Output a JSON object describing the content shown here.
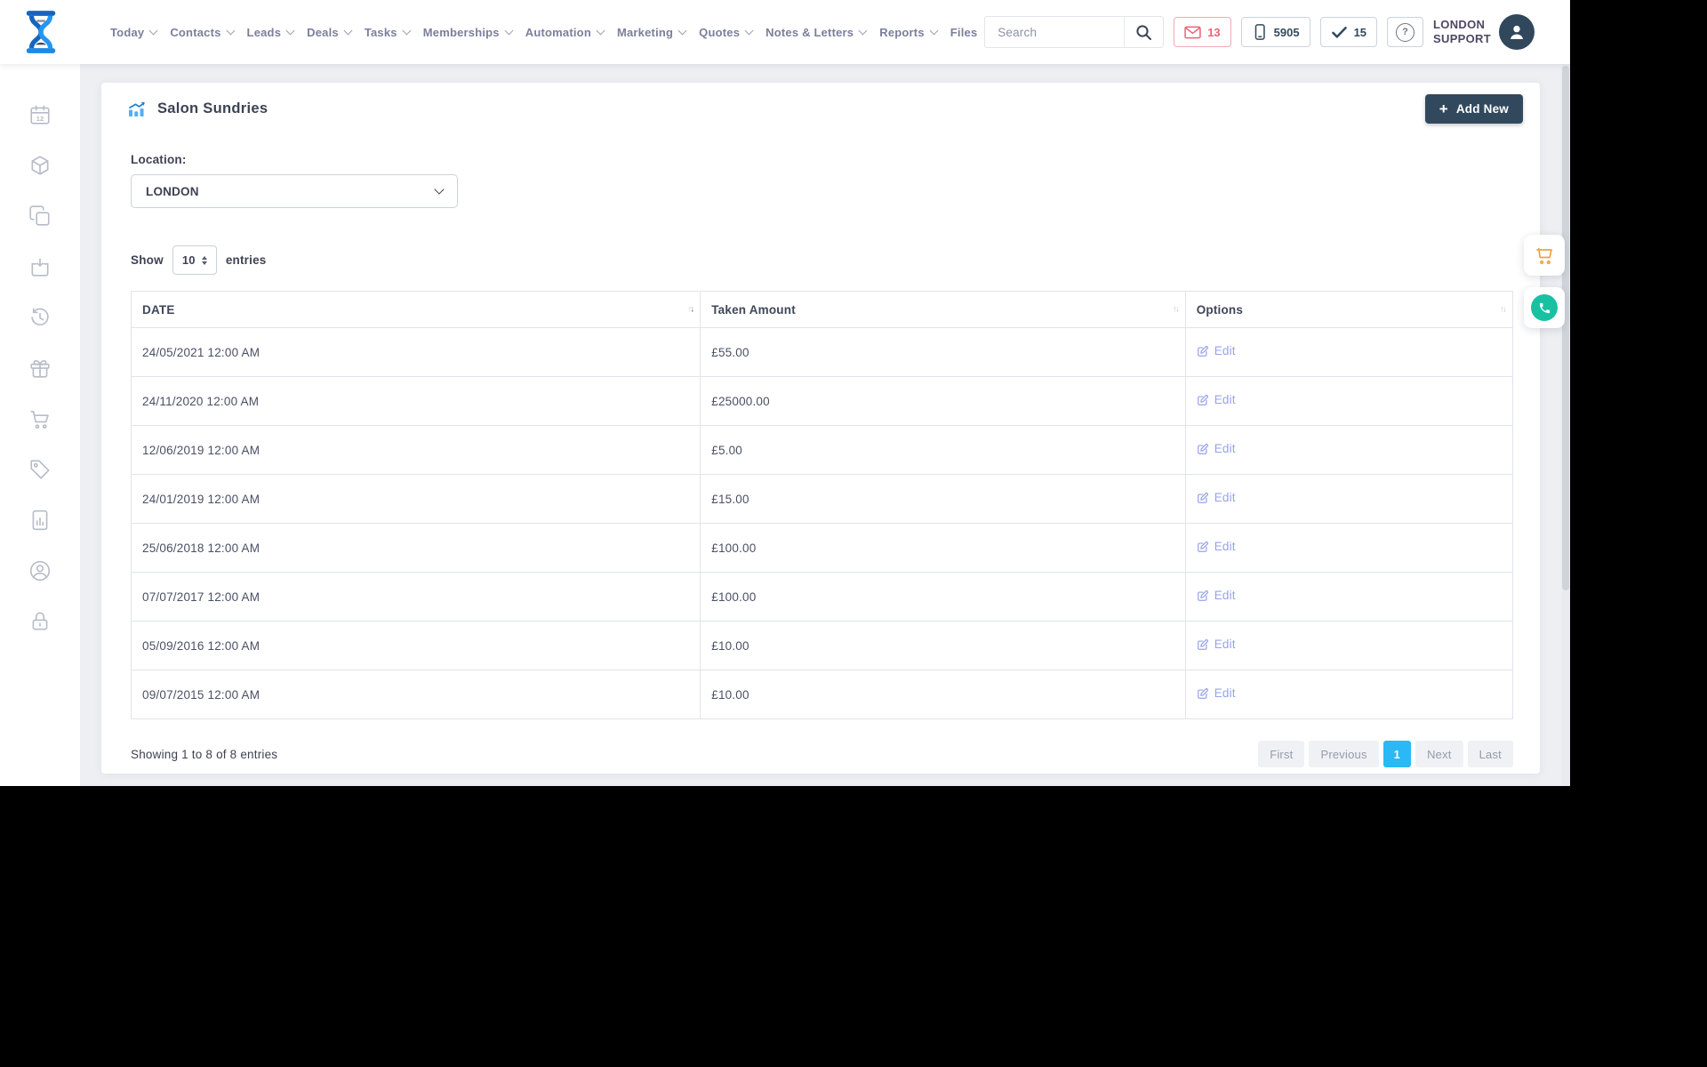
{
  "topbar": {
    "nav": [
      {
        "label": "Today"
      },
      {
        "label": "Contacts"
      },
      {
        "label": "Leads"
      },
      {
        "label": "Deals"
      },
      {
        "label": "Tasks"
      },
      {
        "label": "Memberships"
      },
      {
        "label": "Automation"
      },
      {
        "label": "Marketing"
      },
      {
        "label": "Quotes"
      },
      {
        "label": "Notes & Letters"
      },
      {
        "label": "Reports"
      },
      {
        "label": "Files"
      }
    ],
    "search_placeholder": "Search",
    "messages_count": "13",
    "phone_count": "5905",
    "tasks_count": "15",
    "help_glyph": "?",
    "user_line1": "LONDON",
    "user_line2": "SUPPORT"
  },
  "sidebar": {
    "items": [
      "calendar-icon",
      "package-icon",
      "clone-icon",
      "basket-icon",
      "history-icon",
      "gift-icon",
      "cart-icon",
      "tag-icon",
      "report-icon",
      "account-icon",
      "lock-icon"
    ]
  },
  "page": {
    "title": "Salon Sundries",
    "add_new_label": "Add New",
    "location_label": "Location:",
    "location_value": "LONDON",
    "show_label": "Show",
    "show_value": "10",
    "entries_label": "entries",
    "table": {
      "columns": [
        "DATE",
        "Taken Amount",
        "Options"
      ],
      "rows": [
        {
          "date": "24/05/2021 12:00 AM",
          "amount": "£55.00",
          "action": "Edit"
        },
        {
          "date": "24/11/2020 12:00 AM",
          "amount": "£25000.00",
          "action": "Edit"
        },
        {
          "date": "12/06/2019 12:00 AM",
          "amount": "£5.00",
          "action": "Edit"
        },
        {
          "date": "24/01/2019 12:00 AM",
          "amount": "£15.00",
          "action": "Edit"
        },
        {
          "date": "25/06/2018 12:00 AM",
          "amount": "£100.00",
          "action": "Edit"
        },
        {
          "date": "07/07/2017 12:00 AM",
          "amount": "£100.00",
          "action": "Edit"
        },
        {
          "date": "05/09/2016 12:00 AM",
          "amount": "£10.00",
          "action": "Edit"
        },
        {
          "date": "09/07/2015 12:00 AM",
          "amount": "£10.00",
          "action": "Edit"
        }
      ]
    },
    "footer": {
      "summary": "Showing 1 to 8 of 8 entries",
      "pagination": {
        "first": "First",
        "previous": "Previous",
        "page": "1",
        "next": "Next",
        "last": "Last"
      },
      "active_page": "1"
    }
  },
  "colors": {
    "brand_blue": "#1e88e5",
    "accent_blue": "#2ab8f6",
    "danger_red": "#ee6175",
    "dark_slate": "#32495d",
    "edit_link": "#97a3e8",
    "cart_orange": "#f2a33c",
    "phone_teal": "#17c1a2"
  }
}
